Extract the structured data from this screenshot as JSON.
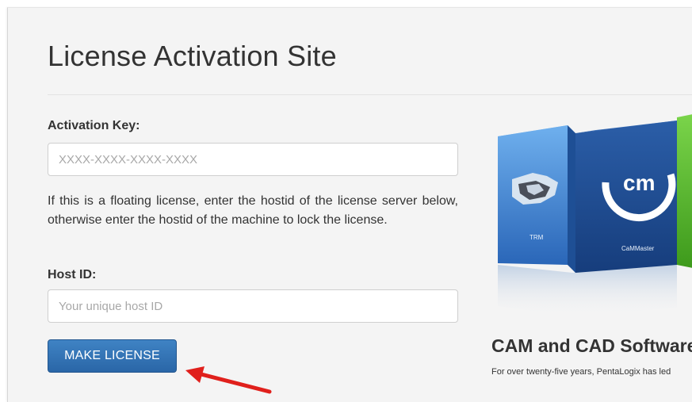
{
  "page": {
    "title": "License Activation Site"
  },
  "form": {
    "activation_key_label": "Activation Key:",
    "activation_key_placeholder": "XXXX-XXXX-XXXX-XXXX",
    "help_text": "If this is a floating license, enter the hostid of the license server below, otherwise enter the hostid of the machine to lock the license.",
    "host_id_label": "Host ID:",
    "host_id_placeholder": "Your unique host ID",
    "submit_label": "MAKE LICENSE"
  },
  "products": {
    "box_labels": [
      "TRM",
      "CaMMaster"
    ],
    "logo_text": "cm"
  },
  "promo": {
    "heading": "CAM and CAD Software",
    "description": "For over twenty-five years, PentaLogix has led"
  },
  "colors": {
    "button": "#2a66a7",
    "annotation_arrow": "#e0201c",
    "box_blue": "#3a7fd0",
    "box_green": "#5cbf2a"
  }
}
